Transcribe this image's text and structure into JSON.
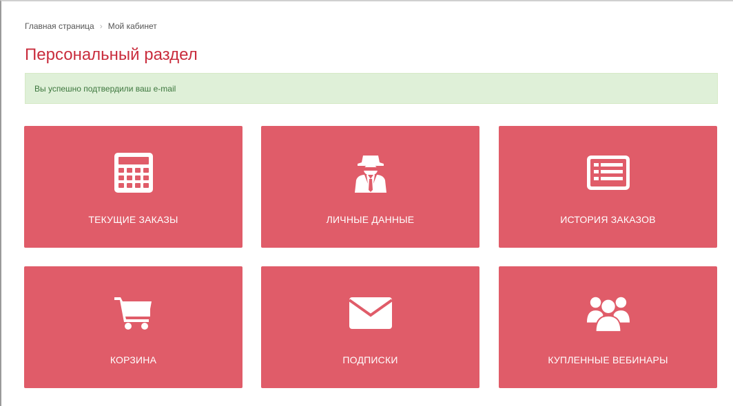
{
  "breadcrumb": {
    "home": "Главная страница",
    "separator": "›",
    "current": "Мой кабинет"
  },
  "page": {
    "title": "Персональный раздел"
  },
  "alert": {
    "text": "Вы успешно подтвердили ваш e-mail"
  },
  "tiles": [
    {
      "label": "ТЕКУЩИЕ ЗАКАЗЫ",
      "icon": "calculator-icon"
    },
    {
      "label": "ЛИЧНЫЕ ДАННЫЕ",
      "icon": "spy-agent-icon"
    },
    {
      "label": "ИСТОРИЯ ЗАКАЗОВ",
      "icon": "list-icon"
    },
    {
      "label": "КОРЗИНА",
      "icon": "shopping-cart-icon"
    },
    {
      "label": "ПОДПИСКИ",
      "icon": "envelope-icon"
    },
    {
      "label": "КУПЛЕННЫЕ ВЕБИНАРЫ",
      "icon": "users-group-icon"
    }
  ],
  "colors": {
    "tile_background": "#e05c69",
    "title": "#c92d3d",
    "alert_background": "#dff0d8",
    "alert_text": "#3c763d"
  }
}
